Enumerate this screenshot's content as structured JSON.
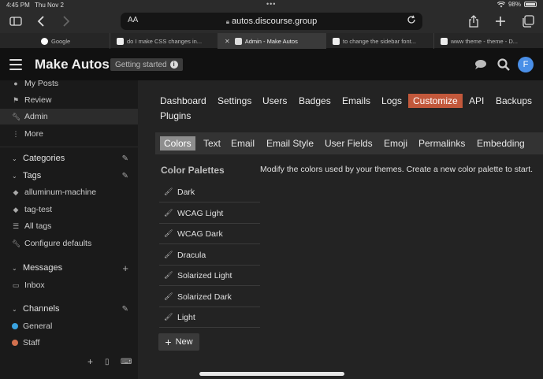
{
  "status": {
    "time": "4:45 PM",
    "date": "Thu Nov 2",
    "battery": "98%"
  },
  "browser": {
    "aa": "AA",
    "url": "autos.discourse.group",
    "tabs": [
      {
        "label": "Google",
        "active": false
      },
      {
        "label": "do I make CSS changes in...",
        "active": false
      },
      {
        "label": "Admin - Make Autos",
        "active": true
      },
      {
        "label": "to change the sidebar font...",
        "active": false
      },
      {
        "label": "www theme - theme - D...",
        "active": false
      }
    ]
  },
  "header": {
    "title": "Make Autos",
    "badge": "Getting started",
    "avatar_letter": "F"
  },
  "sidebar": {
    "top_items": [
      {
        "label": "My Posts",
        "icon": "user-icon"
      },
      {
        "label": "Review",
        "icon": "flag-icon"
      },
      {
        "label": "Admin",
        "icon": "wrench-icon"
      },
      {
        "label": "More",
        "icon": "more-icon"
      }
    ],
    "categories_header": "Categories",
    "tags_header": "Tags",
    "tag_items": [
      {
        "label": "alluminum-machine"
      },
      {
        "label": "tag-test"
      },
      {
        "label": "All tags"
      },
      {
        "label": "Configure defaults"
      }
    ],
    "messages_header": "Messages",
    "inbox": "Inbox",
    "channels_header": "Channels",
    "channels": [
      {
        "label": "General"
      },
      {
        "label": "Staff"
      }
    ]
  },
  "admin_nav": [
    "Dashboard",
    "Settings",
    "Users",
    "Badges",
    "Emails",
    "Logs",
    "Customize",
    "API",
    "Backups",
    "Plugins"
  ],
  "admin_nav_selected": "Customize",
  "sub_nav": [
    "Colors",
    "Text",
    "Email",
    "Email Style",
    "User Fields",
    "Emoji",
    "Permalinks",
    "Embedding"
  ],
  "sub_nav_selected": "Colors",
  "colors": {
    "palettes_title": "Color Palettes",
    "palettes": [
      "Dark",
      "WCAG Light",
      "WCAG Dark",
      "Dracula",
      "Solarized Light",
      "Solarized Dark",
      "Light"
    ],
    "new_label": "New",
    "description": "Modify the colors used by your themes. Create a new color palette to start."
  },
  "theme": {
    "accent": "#c2583b",
    "header_bg": "#111111",
    "main_bg": "#232323"
  }
}
